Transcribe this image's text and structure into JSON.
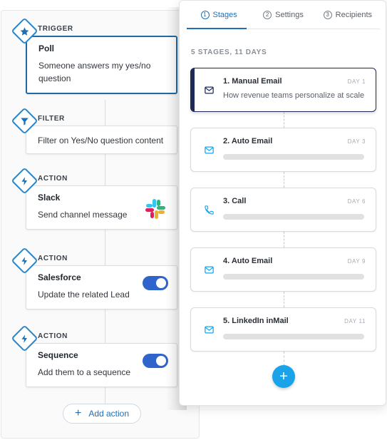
{
  "workflow": {
    "steps": [
      {
        "tag": "TRIGGER",
        "title": "Poll",
        "desc": "Someone answers my yes/no question",
        "icon": "star-icon"
      },
      {
        "tag": "FILTER",
        "title": "",
        "desc": "Filter on Yes/No question content",
        "icon": "filter-icon"
      },
      {
        "tag": "ACTION",
        "title": "Slack",
        "desc": "Send channel message",
        "icon": "bolt-icon"
      },
      {
        "tag": "ACTION",
        "title": "Salesforce",
        "desc": "Update the related Lead",
        "icon": "bolt-icon",
        "toggle_on": true
      },
      {
        "tag": "ACTION",
        "title": "Sequence",
        "desc": "Add them to a sequence",
        "icon": "bolt-icon",
        "toggle_on": true
      }
    ],
    "add_action_label": "Add action"
  },
  "stages_panel": {
    "tabs": [
      {
        "num": "1",
        "label": "Stages",
        "active": true
      },
      {
        "num": "2",
        "label": "Settings",
        "active": false
      },
      {
        "num": "3",
        "label": "Recipients",
        "active": false
      }
    ],
    "summary": "5 STAGES, 11 DAYS",
    "stages": [
      {
        "title": "1. Manual Email",
        "day": "DAY 1",
        "subtitle": "How revenue teams personalize at scale",
        "icon": "envelope-icon"
      },
      {
        "title": "2. Auto Email",
        "day": "DAY 3",
        "icon": "envelope-icon"
      },
      {
        "title": "3. Call",
        "day": "DAY 6",
        "icon": "phone-icon"
      },
      {
        "title": "4. Auto Email",
        "day": "DAY 9",
        "icon": "envelope-icon"
      },
      {
        "title": "5. LinkedIn inMail",
        "day": "DAY 11",
        "icon": "envelope-icon"
      }
    ],
    "add_stage_label": "+"
  },
  "colors": {
    "accent": "#1f6fb5",
    "toggle": "#2f64cc",
    "selected_stage": "#1e2a55",
    "add_button": "#1aa3e8"
  }
}
